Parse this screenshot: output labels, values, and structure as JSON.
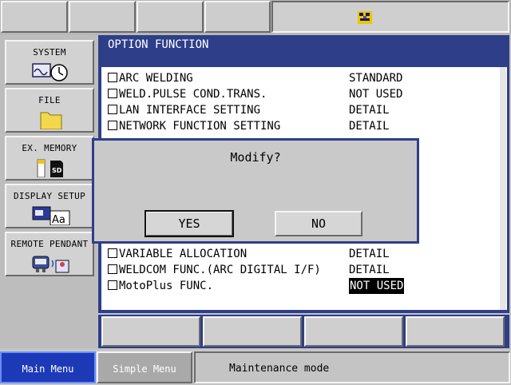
{
  "topbar": {
    "status_icon": "robot-status-icon"
  },
  "sidebar": {
    "items": [
      {
        "label": "SYSTEM",
        "icon": "clock-wave-icon"
      },
      {
        "label": "FILE",
        "icon": "folder-icon"
      },
      {
        "label": "EX. MEMORY",
        "icon": "sd-card-icon"
      },
      {
        "label": "DISPLAY SETUP",
        "icon": "display-font-icon"
      },
      {
        "label": "REMOTE PENDANT",
        "icon": "pendant-icon"
      }
    ]
  },
  "panel": {
    "title": "OPTION FUNCTION",
    "rows_top": [
      {
        "label": "ARC WELDING",
        "value": "STANDARD"
      },
      {
        "label": "WELD.PULSE COND.TRANS.",
        "value": "NOT USED"
      },
      {
        "label": "LAN INTERFACE SETTING",
        "value": "DETAIL"
      },
      {
        "label": "NETWORK FUNCTION SETTING",
        "value": "DETAIL"
      }
    ],
    "rows_bottom": [
      {
        "label": "VARIABLE ALLOCATION",
        "value": "DETAIL"
      },
      {
        "label": "WELDCOM FUNC.(ARC DIGITAL I/F)",
        "value": "DETAIL"
      },
      {
        "label": "MotoPlus FUNC.",
        "value": "NOT USED"
      }
    ]
  },
  "dialog": {
    "message": "Modify?",
    "yes_label": "YES",
    "no_label": "NO"
  },
  "bottombar": {
    "main_menu": "Main Menu",
    "simple_menu": "Simple Menu",
    "message": "Maintenance mode"
  },
  "colors": {
    "panel_blue": "#2e3e88",
    "main_menu_blue": "#1c3ab8"
  }
}
